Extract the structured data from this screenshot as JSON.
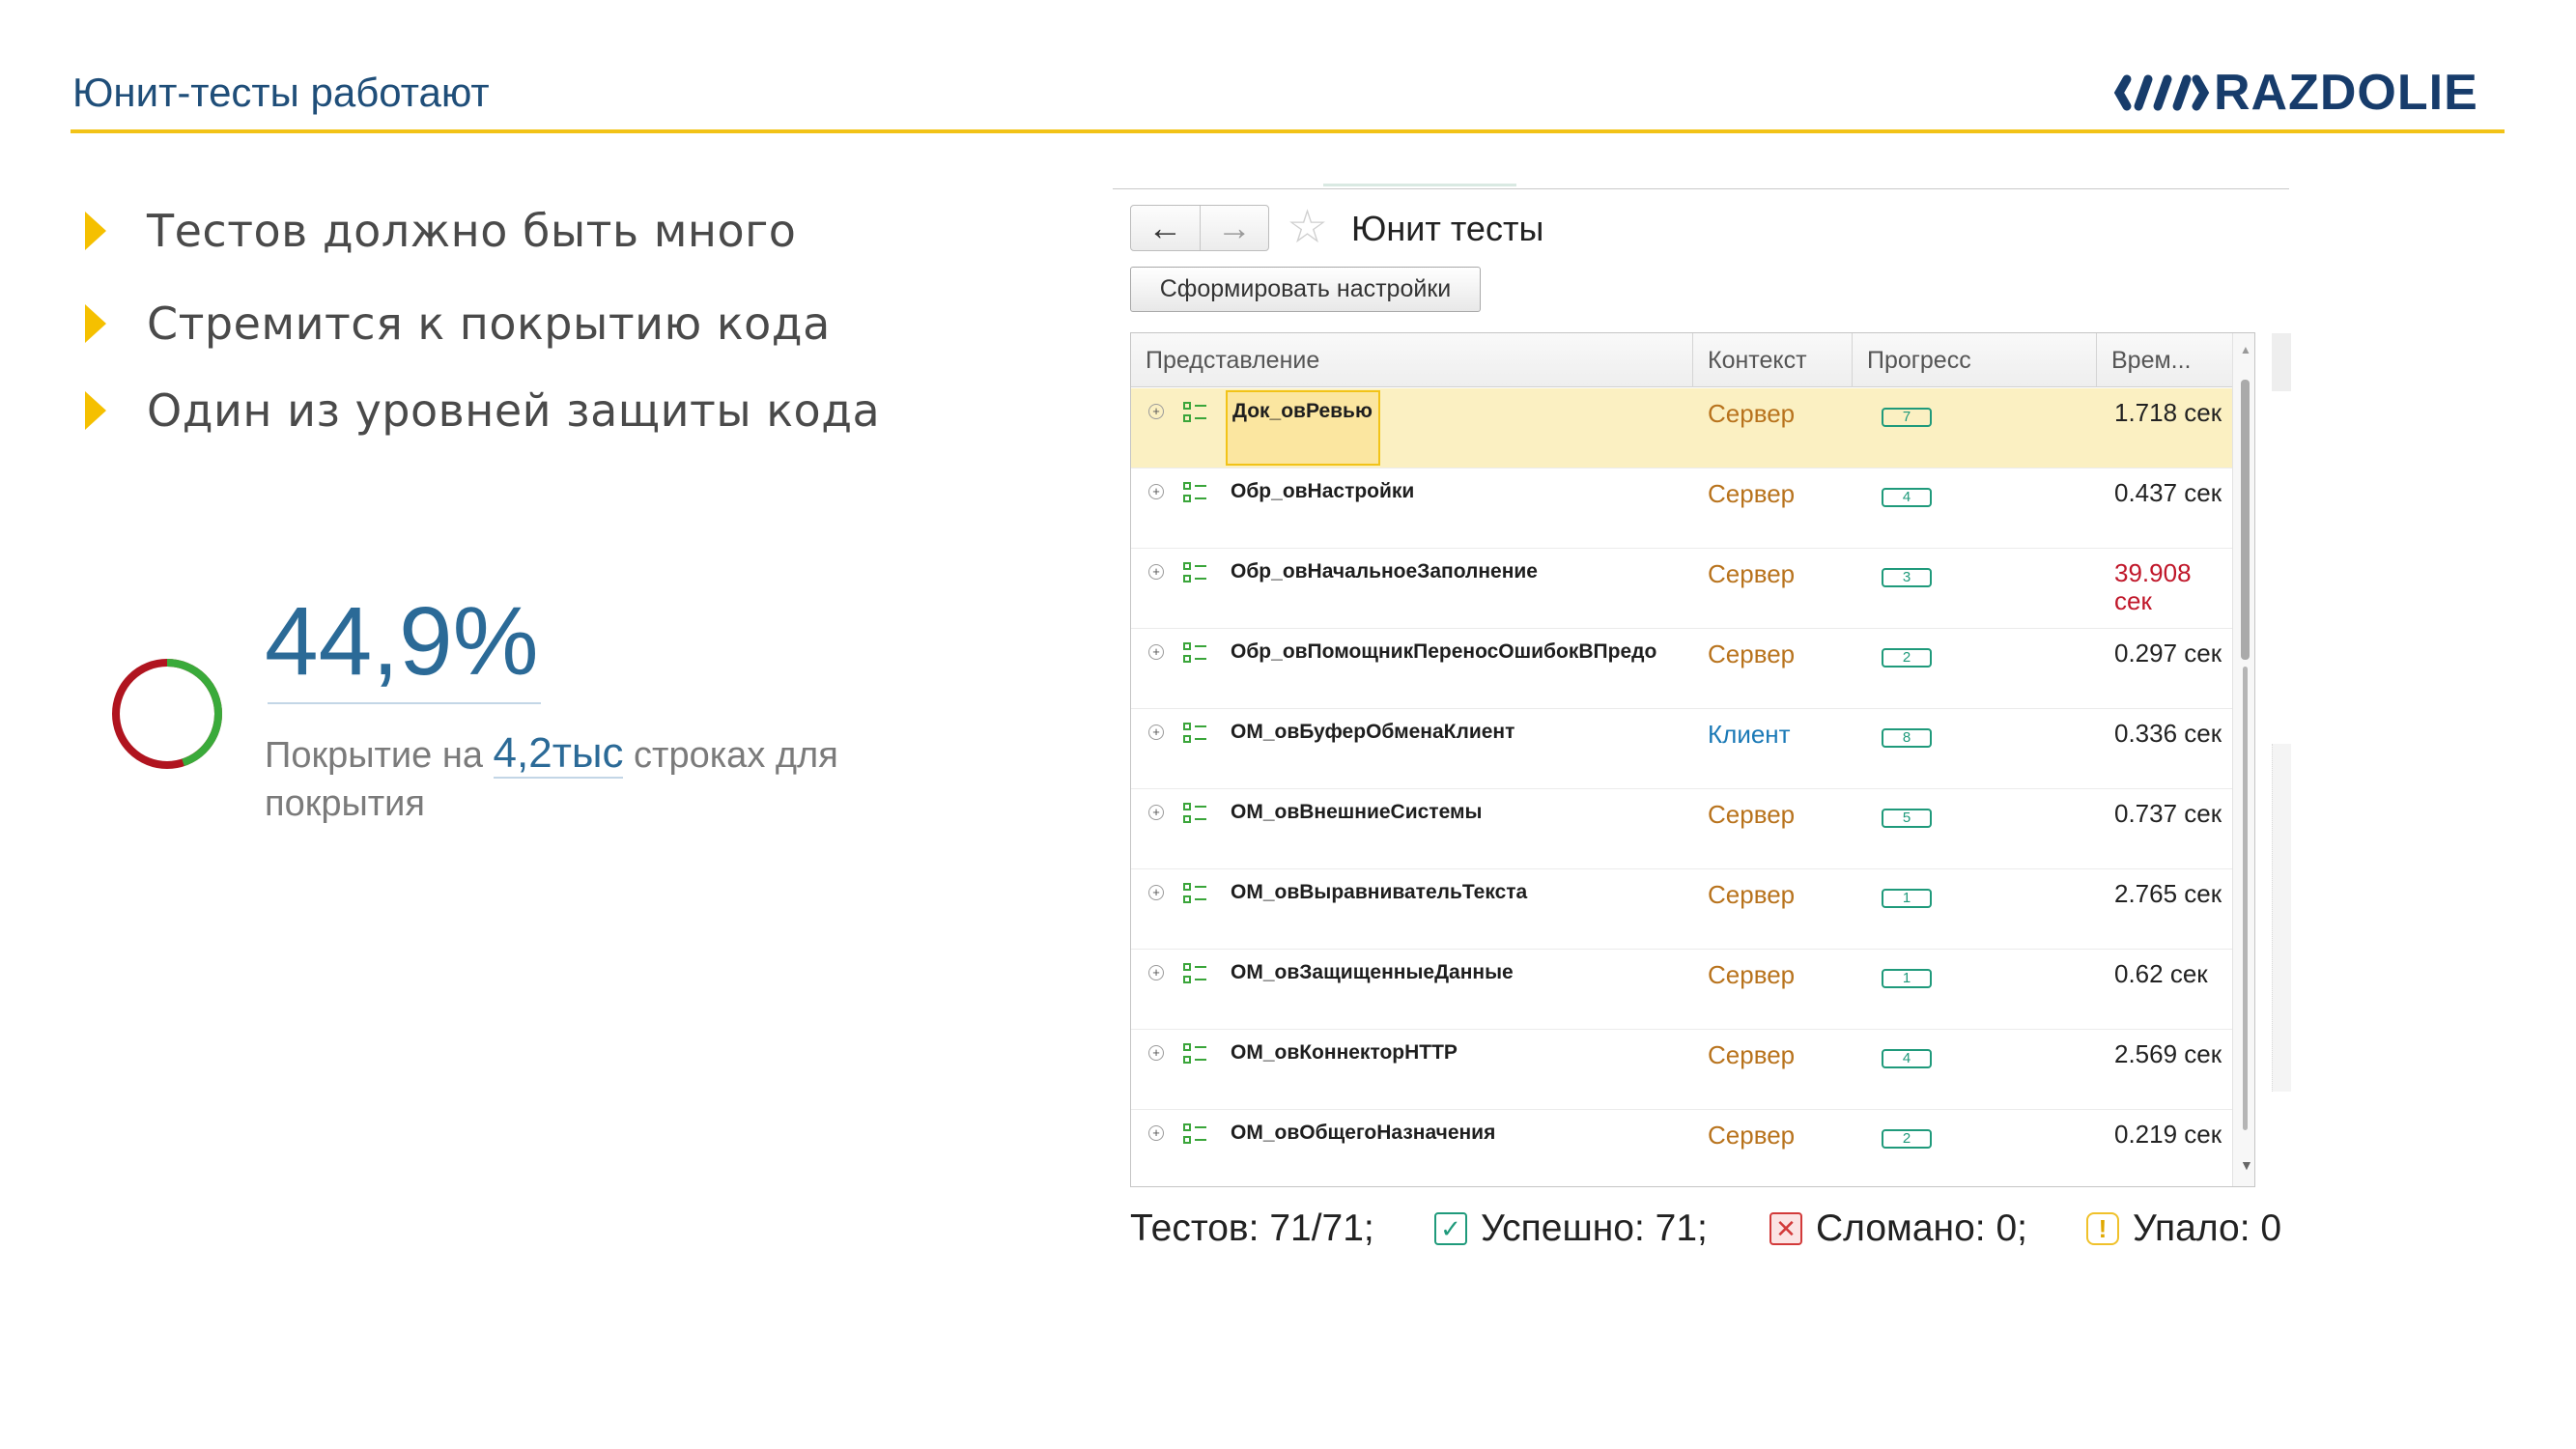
{
  "slide": {
    "title": "Юнит-тесты работают",
    "logo_text": "RAZDOLIE",
    "bullets": [
      "Тестов должно быть много",
      "Стремится к покрытию кода",
      "Один из уровней защиты кода"
    ]
  },
  "coverage": {
    "percent_text": "44,9%",
    "percent": 44.9,
    "desc_before": "Покрытие на",
    "desc_highlight": "4,2тыс",
    "desc_after": "строках для покрытия",
    "ring_colors": {
      "covered": "#3aaa3a",
      "uncovered": "#b0141f"
    }
  },
  "form": {
    "title": "Юнит тесты",
    "nav_back_icon": "arrow-left-icon",
    "nav_forward_icon": "arrow-right-icon",
    "favorite_icon": "star-icon",
    "generate_button": "Сформировать настройки",
    "columns": [
      "Представление",
      "Контекст",
      "Прогресс",
      "Врем..."
    ],
    "rows": [
      {
        "name": "Док_овРевью",
        "context": "Сервер",
        "progress": "7",
        "time": "1.718 сек",
        "selected": true
      },
      {
        "name": "Обр_овНастройки",
        "context": "Сервер",
        "progress": "4",
        "time": "0.437 сек"
      },
      {
        "name": "Обр_овНачальноеЗаполнение",
        "context": "Сервер",
        "progress": "3",
        "time": "39.908 сек",
        "slow": true
      },
      {
        "name": "Обр_овПомощникПереносОшибокВПредо",
        "context": "Сервер",
        "progress": "2",
        "time": "0.297 сек"
      },
      {
        "name": "ОМ_овБуферОбменаКлиент",
        "context": "Клиент",
        "progress": "8",
        "time": "0.336 сек"
      },
      {
        "name": "ОМ_овВнешниеСистемы",
        "context": "Сервер",
        "progress": "5",
        "time": "0.737 сек"
      },
      {
        "name": "ОМ_овВыравнивательТекста",
        "context": "Сервер",
        "progress": "1",
        "time": "2.765 сек"
      },
      {
        "name": "ОМ_овЗащищенныеДанные",
        "context": "Сервер",
        "progress": "1",
        "time": "0.62 сек"
      },
      {
        "name": "ОМ_овКоннекторHTTP",
        "context": "Сервер",
        "progress": "4",
        "time": "2.569 сек"
      },
      {
        "name": "ОМ_овОбщегоНазначения",
        "context": "Сервер",
        "progress": "2",
        "time": "0.219 сек"
      }
    ]
  },
  "summary": {
    "tests": "Тестов: 71/71;",
    "success": "Успешно: 71;",
    "broken": "Сломано: 0;",
    "failed": "Упало: 0"
  },
  "colors": {
    "accent_yellow": "#f2c318",
    "title_blue": "#1f4e79",
    "bottom_bar": "#12355e",
    "context_server": "#b8731d",
    "context_client": "#1a79b6",
    "slow_time": "#c0172a",
    "progress_badge": "#1f9a7b"
  }
}
